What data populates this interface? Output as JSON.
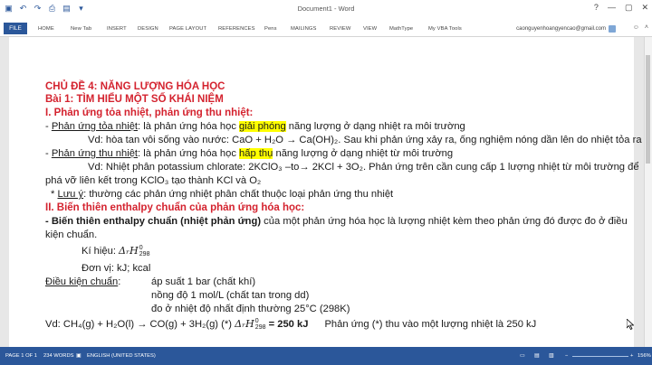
{
  "window": {
    "title": "Document1 - Word",
    "controls": [
      "?",
      "—",
      "▢",
      "✕"
    ]
  },
  "qat_icons": [
    "save-icon",
    "undo-icon",
    "redo-icon",
    "print-icon",
    "open-icon",
    "customize-icon"
  ],
  "ribbon": {
    "file": "FILE",
    "tabs": [
      "HOME",
      "New Tab",
      "INSERT",
      "DESIGN",
      "PAGE LAYOUT",
      "REFERENCES",
      "Pens",
      "MAILINGS",
      "REVIEW",
      "VIEW",
      "MathType",
      "My VBA Tools"
    ],
    "user": "caonguyenhoangyencao@gmail.com"
  },
  "doc": {
    "l1": "CHỦ ĐỀ 4: NĂNG LƯỢNG HÓA HỌC",
    "l2": "Bài 1: TÌM HIỂU MỘT SỐ KHÁI NIỆM",
    "l3": "I. Phản ứng tỏa nhiệt, phản ứng thu nhiệt:",
    "l4a": "- ",
    "l4b": "Phản ứng tỏa nhiệt",
    "l4c": ": là phản ứng hóa học ",
    "l4d": "giải phóng",
    "l4e": " năng lượng ở dạng nhiệt ra môi trường",
    "l5": "Vd: hòa tan vôi sống vào nước: CaO + H₂O → Ca(OH)₂. Sau khi phản ứng xảy ra, ống nghiệm nóng dần lên do nhiệt tỏa ra",
    "l6a": "- ",
    "l6b": "Phản ứng thu nhiệt",
    "l6c": ": là phản ứng hóa học ",
    "l6d": "hấp thụ",
    "l6e": " năng lượng ở dạng nhiệt từ môi trường",
    "l7": "Vd: Nhiệt phân potassium chlorate: 2KClO₃ –to→ 2KCl + 3O₂. Phản ứng trên cần cung cấp 1 lượng nhiệt từ môi trường để",
    "l8": "phá vỡ liên kết trong KClO₃ tạo thành KCl và O₂",
    "l9a": " * ",
    "l9b": "Lưu ý",
    "l9c": ": thường các phản ứng nhiệt phân chất thuộc loại phản ứng thu nhiệt",
    "l10": "II. Biến thiên enthalpy chuẩn của phản ứng hóa học:",
    "l11a": "- Biến thiên enthalpy chuẩn (nhiệt phản ứng)",
    "l11b": " của một phản ứng hóa học là lượng nhiệt kèm theo phản ứng đó được đo ở điều",
    "l12": "kiện chuẩn.",
    "l13a": "Kí hiệu: ",
    "l13b": "ΔᵣH",
    "l13sup": "0",
    "l13sub": "298",
    "l14": "Đơn vị: kJ; kcal",
    "l15a": "Điều kiện chuẩn",
    "l15b": ":",
    "l15c": "áp suất 1 bar (chất khí)",
    "l16": "nồng độ 1 mol/L (chất tan trong dd)",
    "l17": "đo ở nhiệt độ nhất định thường 25°C (298K)",
    "l18a": "Vd: CH₄(g) + H₂O(l) → CO(g) + 3H₂(g) (*) ",
    "l18b": "ΔᵣH",
    "l18sup": "0",
    "l18sub": "298",
    "l18c": " = 250 kJ",
    "l18d": "Phản ứng (*) thu vào một lượng nhiệt là 250 kJ"
  },
  "status": {
    "page": "PAGE 1 OF 1",
    "words": "234 WORDS",
    "lang": "ENGLISH (UNITED STATES)",
    "zoom": "156%"
  },
  "colors": {
    "word_blue": "#2b579a",
    "heading_red": "#d4232f",
    "highlight": "#ffff00"
  }
}
